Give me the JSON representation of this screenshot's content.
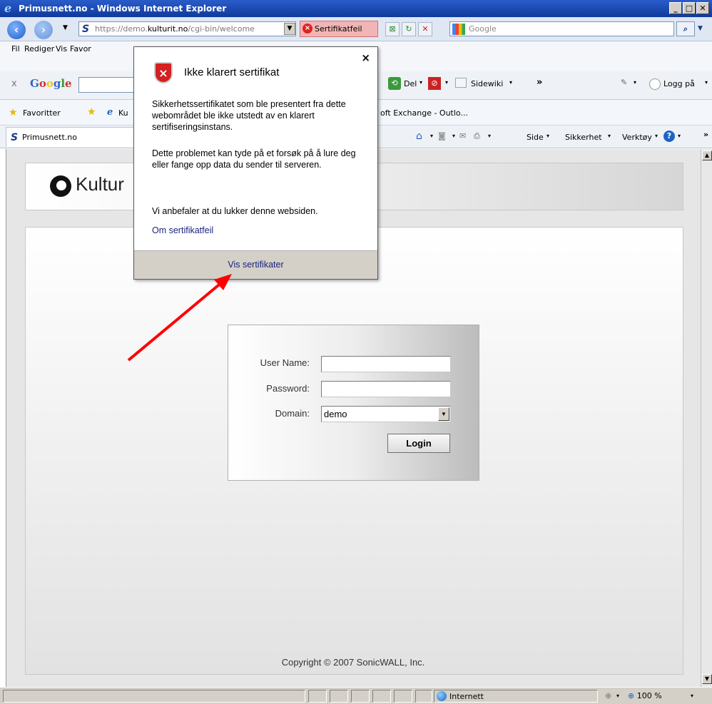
{
  "window": {
    "title": "Primusnett.no - Windows Internet Explorer",
    "minimize": "_",
    "maximize": "□",
    "close": "✕"
  },
  "address": {
    "url_prefix": "https://demo.",
    "url_domain": "kulturit.no",
    "url_path": "/cgi-bin/welcome",
    "cert_error": "Sertifikatfeil",
    "search_placeholder": "Google"
  },
  "menu": {
    "items": [
      "Fil",
      "Rediger",
      "Vis",
      "Favor"
    ]
  },
  "google_toolbar": {
    "close": "x",
    "logo": "Google",
    "del_label": "Del",
    "sidewiki_label": "Sidewiki",
    "more": "»",
    "login_label": "Logg på"
  },
  "favorites": {
    "label": "Favoritter",
    "item_short": "Ku",
    "item_exchange": "oft Exchange - Outlo..."
  },
  "tab": {
    "label": "Primusnett.no"
  },
  "command_bar": {
    "side": "Side",
    "security": "Sikkerhet",
    "tools": "Verktøy"
  },
  "page": {
    "logo_text": "Kultur",
    "login": {
      "username_label": "User Name:",
      "password_label": "Password:",
      "domain_label": "Domain:",
      "username_value": "",
      "password_value": "",
      "domain_value": "demo",
      "login_button": "Login"
    },
    "copyright": "Copyright © 2007 SonicWALL, Inc."
  },
  "popup": {
    "title": "Ikke klarert sertifikat",
    "para1": "Sikkerhetssertifikatet som ble presentert fra dette webområdet ble ikke utstedt av en klarert sertifiseringsinstans.",
    "para2": "Dette problemet kan tyde på et forsøk på å lure deg eller fange opp data du sender til serveren.",
    "para3": "Vi anbefaler at du lukker denne websiden.",
    "link": "Om sertifikatfeil",
    "footer_link": "Vis sertifikater",
    "close": "×"
  },
  "status": {
    "zone": "Internett",
    "zoom": "100 %"
  },
  "colors": {
    "annotation_arrow": "#ff0000",
    "cert_error_bg": "#f2b5b5"
  }
}
